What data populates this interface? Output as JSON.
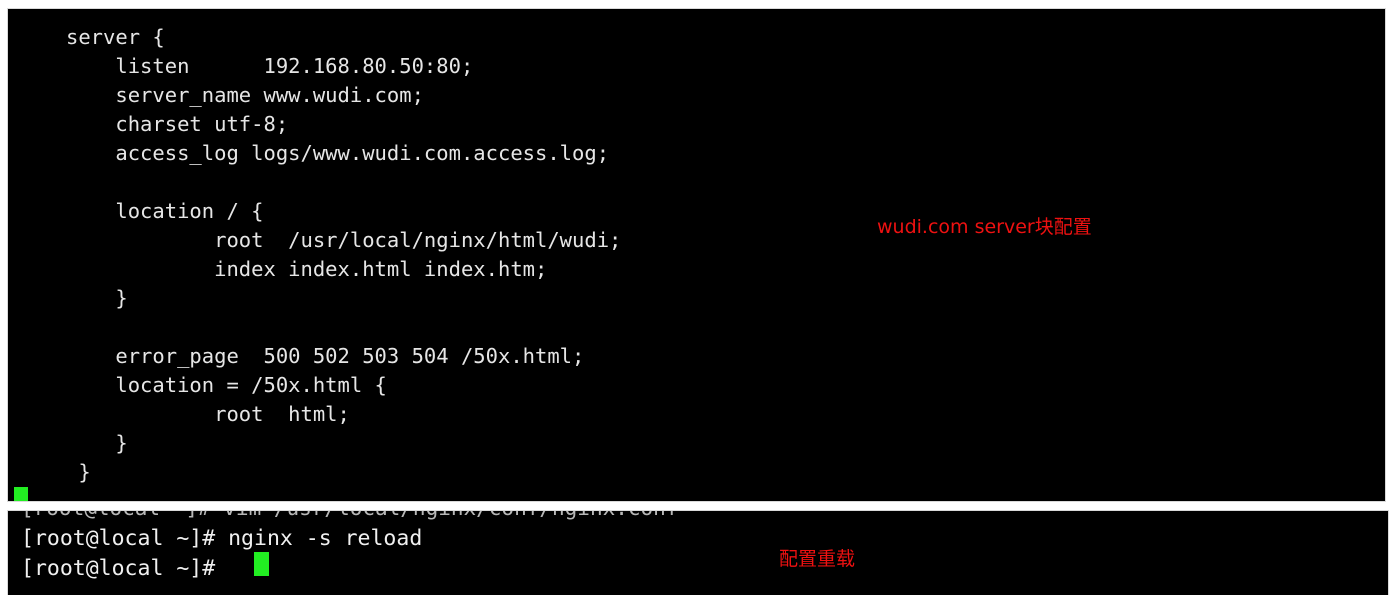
{
  "window": {
    "background_color": "#ffffff",
    "terminal_background": "#000000",
    "terminal_foreground": "#e6e6e6",
    "annotation_color": "#ee1111",
    "cursor_color": "#22ee22"
  },
  "config_panel": {
    "name": "nginx-config-viewer",
    "lines": [
      "server {",
      "    listen      192.168.80.50:80;",
      "    server_name www.wudi.com;",
      "    charset utf-8;",
      "    access_log logs/www.wudi.com.access.log;",
      "",
      "    location / {",
      "            root  /usr/local/nginx/html/wudi;",
      "            index index.html index.htm;",
      "    }",
      "",
      "    error_page  500 502 503 504 /50x.html;",
      "    location = /50x.html {",
      "            root  html;",
      "    }",
      " }"
    ],
    "annotation": "wudi.com server块配置",
    "cursor": "block-cursor"
  },
  "shell_panel": {
    "name": "shell-terminal",
    "clipped_line": "[root@local ~]# vim /usr/local/nginx/conf/nginx.conf",
    "lines": [
      "[root@local ~]# nginx -s reload",
      "[root@local ~]# "
    ],
    "prompt": "[root@local ~]#",
    "command": "nginx -s reload",
    "annotation": "配置重载",
    "cursor": "block-cursor"
  }
}
